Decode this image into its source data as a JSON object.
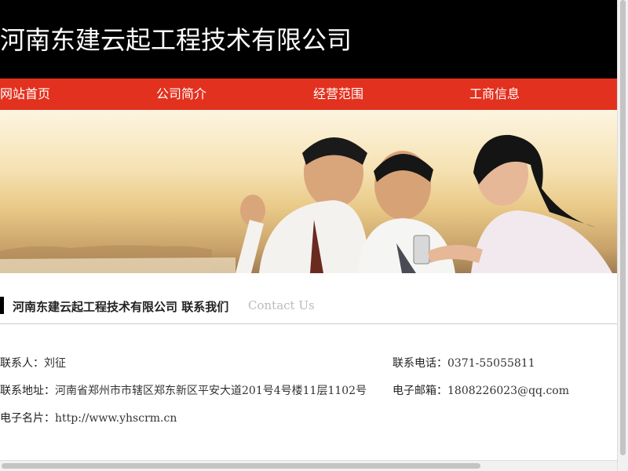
{
  "header": {
    "title": "河南东建云起工程技术有限公司"
  },
  "nav": {
    "items": [
      "网站首页",
      "公司简介",
      "经营范围",
      "工商信息"
    ]
  },
  "section": {
    "title": "河南东建云起工程技术有限公司 联系我们",
    "subtitle": "Contact Us"
  },
  "contact": {
    "person_label": "联系人：",
    "person": "刘征",
    "phone_label": "联系电话：",
    "phone": "0371-55055811",
    "address_label": "联系地址：",
    "address": "河南省郑州市市辖区郑东新区平安大道201号4号楼11层1102号",
    "email_label": "电子邮箱：",
    "email": "1808226023@qq.com",
    "card_label": "电子名片：",
    "card": "http://www.yhscrm.cn"
  },
  "colors": {
    "header_bg": "#000000",
    "nav_bg": "#e3311f",
    "accent_bar": "#000000"
  }
}
